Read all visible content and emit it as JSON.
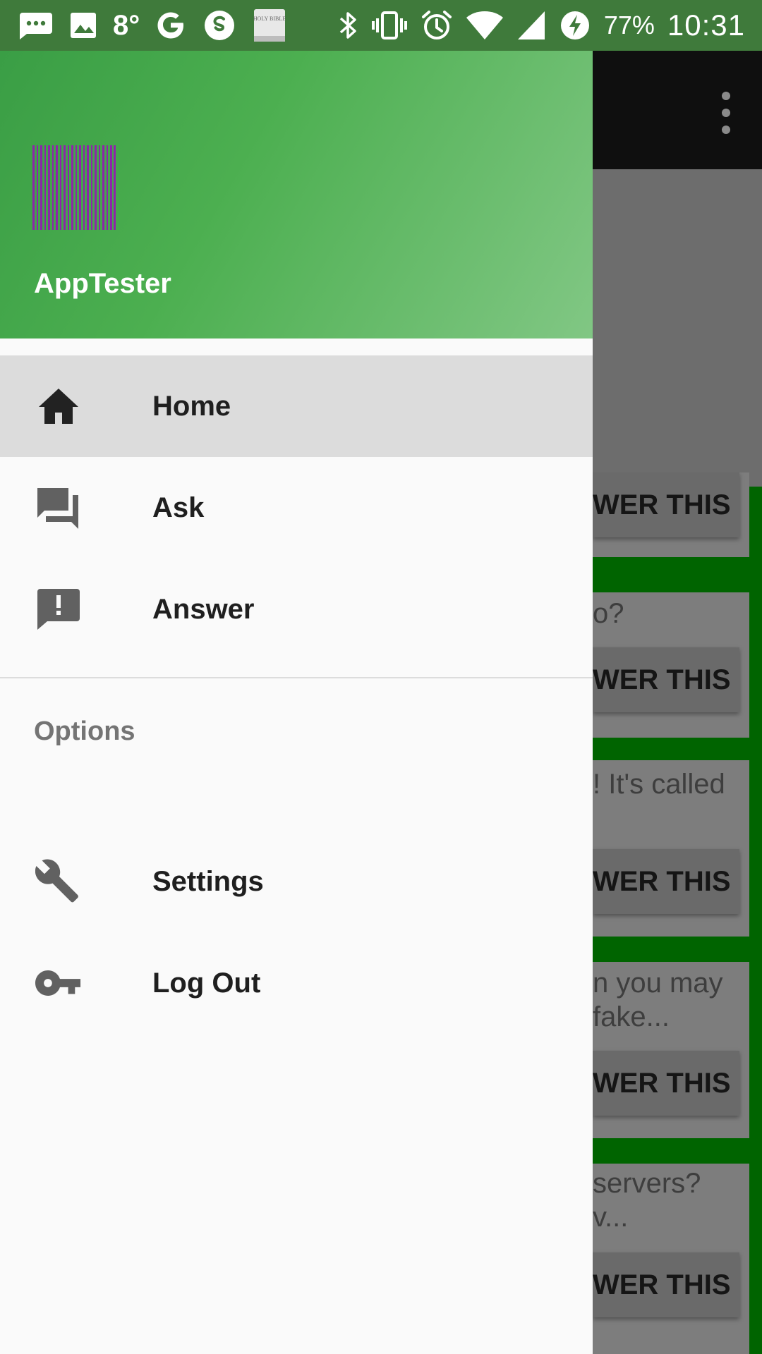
{
  "status_bar": {
    "temperature": "8°",
    "battery": "77%",
    "time": "10:31",
    "icons": [
      "messaging-icon",
      "gallery-icon",
      "temperature-text",
      "google-icon",
      "skype-icon",
      "holy-bible-icon",
      "bluetooth-icon",
      "vibrate-icon",
      "alarm-icon",
      "wifi-icon",
      "signal-icon",
      "battery-charging-icon"
    ],
    "bible_icon_text": "HOLY BIBLE"
  },
  "drawer": {
    "app_name": "AppTester",
    "nav_items": [
      {
        "label": "Home",
        "icon": "home-icon",
        "active": true
      },
      {
        "label": "Ask",
        "icon": "forum-icon",
        "active": false
      },
      {
        "label": "Answer",
        "icon": "feedback-icon",
        "active": false
      }
    ],
    "section_title": "Options",
    "option_items": [
      {
        "label": "Settings",
        "icon": "wrench-icon"
      },
      {
        "label": "Log Out",
        "icon": "key-icon"
      }
    ]
  },
  "background_app": {
    "cards": [
      {
        "text": "",
        "button": "WER THIS"
      },
      {
        "text": "o?",
        "button": "WER THIS"
      },
      {
        "text": "! It's called",
        "button": "WER THIS"
      },
      {
        "text": "n you may\nfake...",
        "button": "WER THIS"
      },
      {
        "text": "servers?\nv...",
        "button": "WER THIS"
      }
    ]
  },
  "colors": {
    "status_bar": "#3f7a3b",
    "drawer_header_start": "#3a9e45",
    "drawer_header_end": "#81c784",
    "barcode": "#8e24aa",
    "content_green": "#006400",
    "active_item_bg": "#dcdcdc"
  }
}
